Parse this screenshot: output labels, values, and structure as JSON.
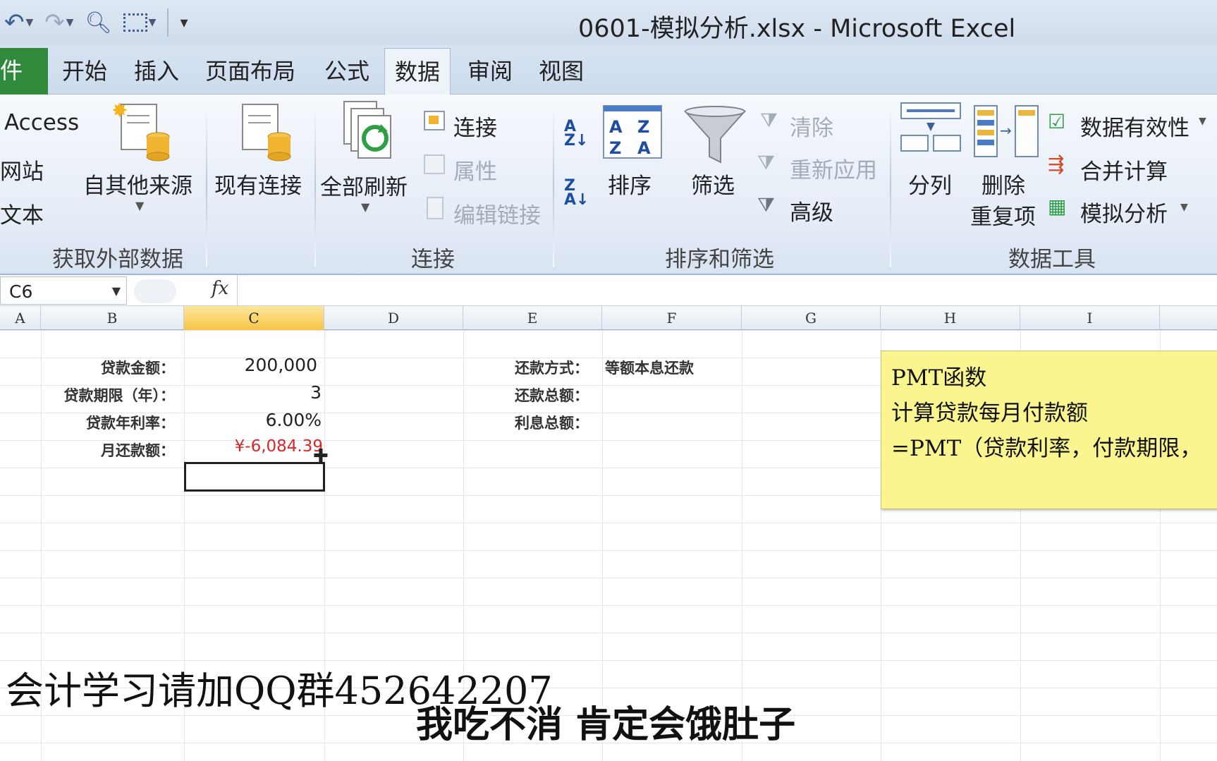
{
  "window": {
    "title": "0601-模拟分析.xlsx  -  Microsoft Excel"
  },
  "tabs": {
    "file": "件",
    "home": "开始",
    "insert": "插入",
    "page_layout": "页面布局",
    "formulas": "公式",
    "data": "数据",
    "review": "审阅",
    "view": "视图"
  },
  "ribbon": {
    "get_external": {
      "access": "Access",
      "web": "网站",
      "text": "文本",
      "other_sources": "自其他来源",
      "existing": "现有连接",
      "group": "获取外部数据"
    },
    "connections": {
      "refresh_all": "全部刷新",
      "connections": "连接",
      "properties": "属性",
      "edit_links": "编辑链接",
      "group": "连接"
    },
    "sort_filter": {
      "sort": "排序",
      "filter": "筛选",
      "clear": "清除",
      "reapply": "重新应用",
      "advanced": "高级",
      "group": "排序和筛选"
    },
    "data_tools": {
      "text_to_columns": "分列",
      "remove_dup_1": "删除",
      "remove_dup_2": "重复项",
      "validation": "数据有效性",
      "consolidate": "合并计算",
      "what_if": "模拟分析",
      "group": "数据工具"
    }
  },
  "formula_bar": {
    "name_box": "C6",
    "fx": "fx",
    "formula": ""
  },
  "columns": [
    "A",
    "B",
    "C",
    "D",
    "E",
    "F",
    "G",
    "H",
    "I"
  ],
  "cells": {
    "b2": "贷款金额：",
    "c2": "200,000",
    "b3": "贷款期限（年）：",
    "c3": "3",
    "b4": "贷款年利率：",
    "c4": "6.00%",
    "b5": "月还款额：",
    "c5": "¥-6,084.39",
    "e2": "还款方式：",
    "f2": "等额本息还款",
    "e3": "还款总额：",
    "e4": "利息总额："
  },
  "note": {
    "line1": "PMT函数",
    "line2": "计算贷款每月付款额",
    "line3": "=PMT（贷款利率，付款期限，"
  },
  "overlay": {
    "watermark": "会计学习请加QQ群452642207",
    "subtitle": "我吃不消 肯定会饿肚子"
  },
  "colors": {
    "accent": "#2f8a3c",
    "negative": "#d9262b",
    "note_bg": "#fbf58f",
    "selected_header": "#f6c546"
  }
}
